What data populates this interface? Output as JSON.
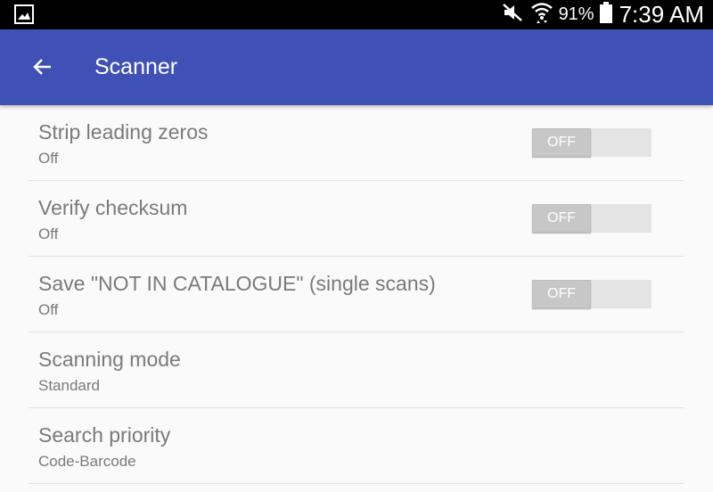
{
  "status_bar": {
    "battery_percent": "91%",
    "time": "7:39 AM"
  },
  "app_bar": {
    "title": "Scanner"
  },
  "settings": [
    {
      "title": "Strip leading zeros",
      "summary": "Off",
      "toggle": "OFF"
    },
    {
      "title": "Verify checksum",
      "summary": "Off",
      "toggle": "OFF"
    },
    {
      "title": "Save \"NOT IN CATALOGUE\" (single scans)",
      "summary": "Off",
      "toggle": "OFF"
    },
    {
      "title": "Scanning mode",
      "summary": "Standard"
    },
    {
      "title": "Search priority",
      "summary": "Code-Barcode"
    }
  ],
  "colors": {
    "app_bar": "#3f51b5",
    "background": "#fafafa",
    "text": "#7a7a7a"
  }
}
